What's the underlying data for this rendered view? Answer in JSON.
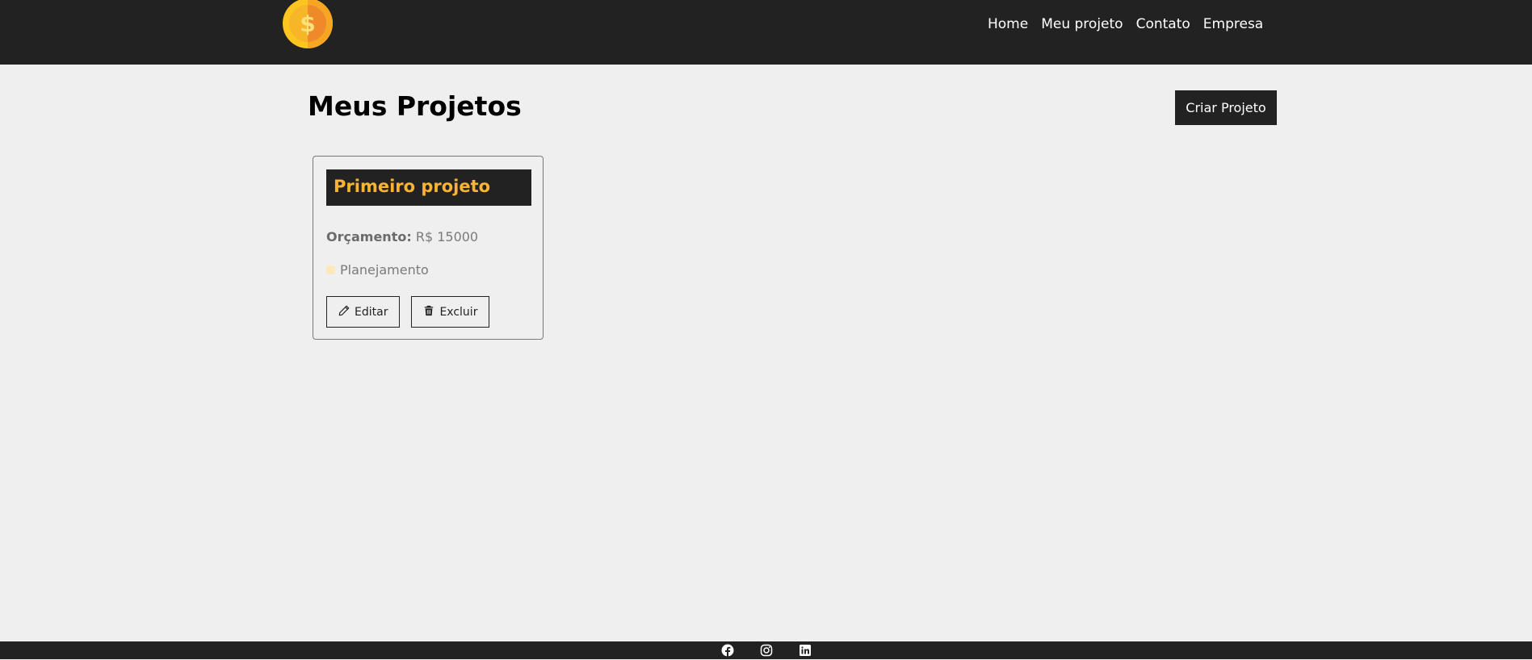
{
  "navbar": {
    "links": [
      "Home",
      "Meu projeto",
      "Contato",
      "Empresa"
    ]
  },
  "page": {
    "title": "Meus Projetos",
    "create_button": "Criar Projeto"
  },
  "projects": [
    {
      "name": "Primeiro projeto",
      "budget_label": "Orçamento:",
      "budget_value": "R$ 15000",
      "category": "Planejamento",
      "edit_label": "Editar",
      "delete_label": "Excluir"
    }
  ],
  "colors": {
    "dark": "#222222",
    "accent": "#fbb431",
    "background": "#efefef"
  },
  "footer": {
    "icons": [
      "facebook-icon",
      "instagram-icon",
      "linkedin-icon"
    ]
  }
}
